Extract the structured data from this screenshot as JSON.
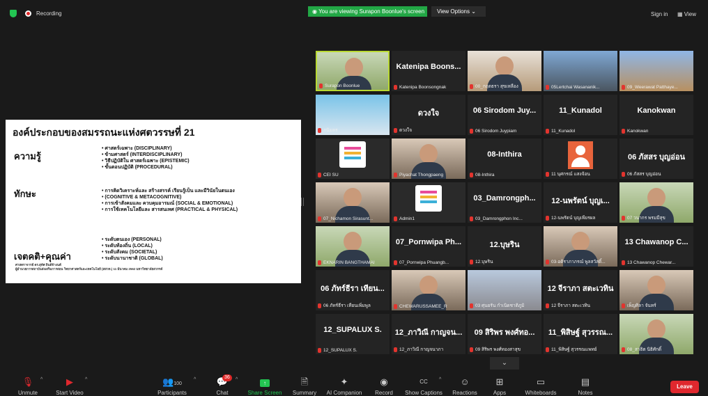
{
  "topbar": {
    "recording_label": "Recording",
    "viewing_banner": "You are viewing Surapon Boonlue's screen",
    "view_options": "View Options",
    "sign_in": "Sign in",
    "view": "View"
  },
  "slide": {
    "title": "องค์ประกอบของสมรรถนะแห่งศตวรรษที่ 21",
    "knowledge": {
      "heading": "ความรู้",
      "items": [
        "ศาสตร์เฉพาะ (DISCIPLINARY)",
        "ข้ามศาสตร์ (INTERDISCIPLINARY)",
        "วิธีปฏิบัติใน ศาสตร์เฉพาะ (EPISTEMIC)",
        "ขั้นตอนปฏิบัติ (PROCEDURAL)"
      ]
    },
    "skills": {
      "heading": "ทักษะ",
      "items": [
        "การคิดวิเคราะห์และ สร้างสรรค์ เรียนรู้เป็น และมีวินัยในตนเอง",
        "(COGNITIVE & METACOGNITIVE)",
        "การเข้าสังคมและ ควบคุมอารมณ์ (SOCIAL & EMOTIONAL)",
        "การใช้เทคโนโลยีและ สารสนเทศ (PRACTICAL & PHYSICAL)"
      ]
    },
    "attitudes": {
      "heading": "เจตคติ+คุณค่า",
      "items": [
        "ระดับตนเอง (PERSONAL)",
        "ระดับท้องถิ่น (LOCAL)",
        "ระดับสังคม (SOCIETAL)",
        "ระดับนานาชาติ (GLOBAL)"
      ]
    },
    "footer_line1": "ศาสตราจารย์ ดร.สุทัศ ยินดีจ้างนต์",
    "footer_line2": "ผู้อำนวยการสถาบันส่งเสริมการสอน วิทยาศาสตร์และเทคโนโลยี (สสวท.) 11 มีนาคม 2562 มหาวิทยาลัยสวรรค์"
  },
  "tiles": [
    {
      "name": "",
      "label": "Surapon Boonlue",
      "kind": "video-man",
      "active": true
    },
    {
      "name": "Katenipa Boons...",
      "label": "Katenipa Boonsongnak"
    },
    {
      "name": "",
      "label": "00_กฤตธรา สุขเหลือง",
      "kind": "video-avatar"
    },
    {
      "name": "",
      "label": "05Lertchai Wasananik...",
      "kind": "video-city"
    },
    {
      "name": "",
      "label": "09_Weerawat Patthaye...",
      "kind": "video-palace"
    },
    {
      "name": "",
      "label": "ภนิมลร",
      "kind": "video-beach"
    },
    {
      "name": "ดวงใจ",
      "label": "ดวงใจ"
    },
    {
      "name": "06 Sirodom Juy...",
      "label": "06 Sirodom Juypiam"
    },
    {
      "name": "11_Kunadol",
      "label": "11_Kunadol"
    },
    {
      "name": "Kanokwan",
      "label": "Kanokwan"
    },
    {
      "name": "",
      "label": "CEI SU",
      "kind": "logo"
    },
    {
      "name": "",
      "label": "Piyachat Thongpaeng",
      "kind": "video-woman"
    },
    {
      "name": "08-Inthira",
      "label": "08-Inthira"
    },
    {
      "name": "",
      "label": "11 นุศกรณ์ แสงจ้อน",
      "kind": "avatar"
    },
    {
      "name": "06 ภัสสร บุญอ่อน",
      "label": "06 ภัสสร บุญอ่อน"
    },
    {
      "name": "",
      "label": "07_Nichamon Sirasunt...",
      "kind": "video-woman"
    },
    {
      "name": "",
      "label": "Admin1",
      "kind": "logo"
    },
    {
      "name": "03_Damrongph...",
      "label": "03_Damrongphon Inc..."
    },
    {
      "name": "12-นพรัตน์ บุญเ...",
      "label": "12-นพรัตน์ บุญเพียรผล"
    },
    {
      "name": "",
      "label": "07 วนากร พรมมีสุข",
      "kind": "video-man"
    },
    {
      "name": "",
      "label": "EKNARIN BANGTHAMAI",
      "kind": "video-man"
    },
    {
      "name": "07_Pornwipa Ph...",
      "label": "07_Pornwipa Phuangb..."
    },
    {
      "name": "12.บุษริน",
      "label": "12.บุษริน"
    },
    {
      "name": "",
      "label": "03-อดิราภาภรณ์ พูลสวัสดิ์...",
      "kind": "video-woman"
    },
    {
      "name": "13 Chawanop C...",
      "label": "13 Chawanop Chewar..."
    },
    {
      "name": "06 ภัทร์ธีรา เทียน...",
      "label": "06 ภัทร์ธีรา เทียนเพิ่มพูล"
    },
    {
      "name": "",
      "label": "CHEWARUSSAMEE_R",
      "kind": "video-woman"
    },
    {
      "name": "",
      "label": "03 ศุนยรัน กำเนิดชาติภูมิ",
      "kind": "video-cathedral"
    },
    {
      "name": "12 จีราภา สตะเวทิน",
      "label": "12 จีราภา สตะเวทิน"
    },
    {
      "name": "",
      "label": "เพ็ญศิลา จันทร์",
      "kind": "video-woman"
    },
    {
      "name": "12_SUPALUX S.",
      "label": "12_SUPALUX S."
    },
    {
      "name": "12_ภาวิณี กาญจน...",
      "label": "12_ภาวิณี กาญจนาภา"
    },
    {
      "name": "09 สิริพร พงศ์ทอ...",
      "label": "09 สิริพร พงศ์ทองสาสุข"
    },
    {
      "name": "11_พิสิษฐ์ สุวรรณ...",
      "label": "11_พิสิษฐ์ สุวรรณแพทย์"
    },
    {
      "name": "",
      "label": "08_สาธิต นิธิศักดิ์",
      "kind": "video-man"
    }
  ],
  "toolbar": {
    "unmute": "Unmute",
    "start_video": "Start Video",
    "participants": "Participants",
    "participants_count": "100",
    "chat": "Chat",
    "chat_badge": "36",
    "share_screen": "Share Screen",
    "summary": "Summary",
    "ai_companion": "AI Companion",
    "record": "Record",
    "show_captions": "Show Captions",
    "reactions": "Reactions",
    "apps": "Apps",
    "whiteboards": "Whiteboards",
    "notes": "Notes",
    "leave": "Leave"
  },
  "colors": {
    "accent_green": "#23c552",
    "leave_red": "#e0282e",
    "active_border": "#b9d932"
  }
}
